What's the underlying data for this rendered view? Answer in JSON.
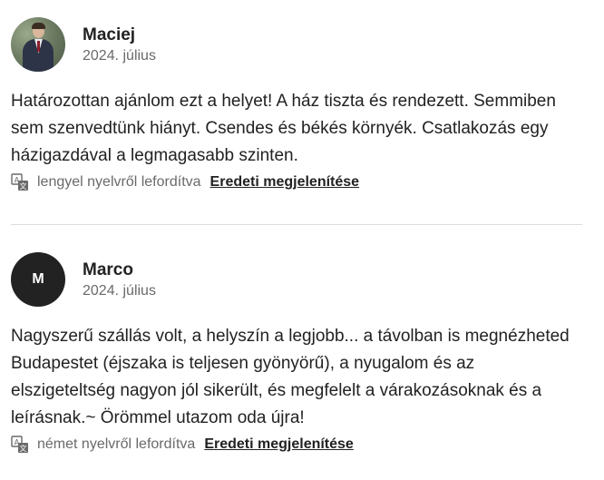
{
  "reviews": [
    {
      "name": "Maciej",
      "date": "2024. július",
      "text": "Határozottan ajánlom ezt a helyet! A ház tiszta és rendezett. Semmiben sem szenvedtünk hiányt. Csendes és békés környék. Csatlakozás egy házigazdával a legmagasabb szinten.",
      "translated_from": "lengyel nyelvről lefordítva",
      "show_original": "Eredeti megjelenítése",
      "avatar": "photo"
    },
    {
      "name": "Marco",
      "date": "2024. július",
      "avatar_letter": "M",
      "text": "Nagyszerű szállás volt, a helyszín a legjobb... a távolban is megnézheted Budapestet (éjszaka is teljesen gyönyörű), a nyugalom és az elszigeteltség nagyon jól sikerült, és megfelelt a várakozásoknak és a leírásnak.~ Örömmel utazom oda újra!",
      "translated_from": "német nyelvről lefordítva",
      "show_original": "Eredeti megjelenítése"
    }
  ],
  "icons": {
    "translate": "translate-icon"
  },
  "colors": {
    "text": "#222222",
    "muted": "#6a6a6a",
    "divider": "#dddddd",
    "avatar_bg": "#222222"
  }
}
